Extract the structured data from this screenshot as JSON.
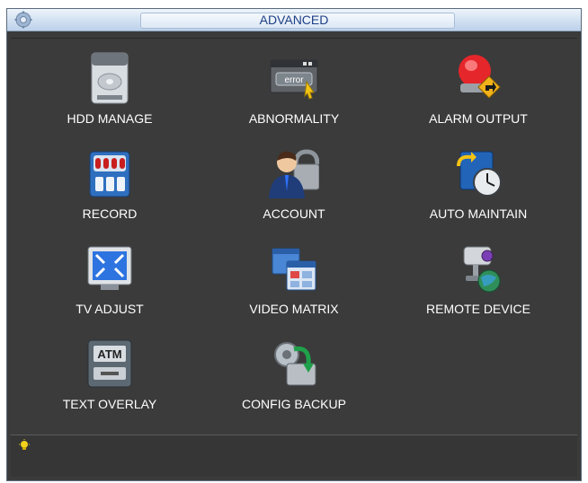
{
  "window": {
    "title": "ADVANCED"
  },
  "menu": [
    {
      "label": "HDD MANAGE",
      "icon": "hdd-icon"
    },
    {
      "label": "ABNORMALITY",
      "icon": "error-window-icon"
    },
    {
      "label": "ALARM OUTPUT",
      "icon": "alarm-siren-icon"
    },
    {
      "label": "RECORD",
      "icon": "record-panel-icon"
    },
    {
      "label": "ACCOUNT",
      "icon": "account-lock-icon"
    },
    {
      "label": "AUTO MAINTAIN",
      "icon": "auto-maintain-clock-icon"
    },
    {
      "label": "TV ADJUST",
      "icon": "tv-adjust-icon"
    },
    {
      "label": "VIDEO MATRIX",
      "icon": "video-matrix-icon"
    },
    {
      "label": "REMOTE DEVICE",
      "icon": "remote-camera-icon"
    },
    {
      "label": "TEXT OVERLAY",
      "icon": "atm-icon"
    },
    {
      "label": "CONFIG BACKUP",
      "icon": "config-backup-icon"
    }
  ],
  "icons": {
    "abnormality_text": "error",
    "text_overlay_text": "ATM"
  },
  "colors": {
    "background": "#3b3b3b",
    "title_text": "#1d3f86",
    "label_text": "#ffffff"
  }
}
